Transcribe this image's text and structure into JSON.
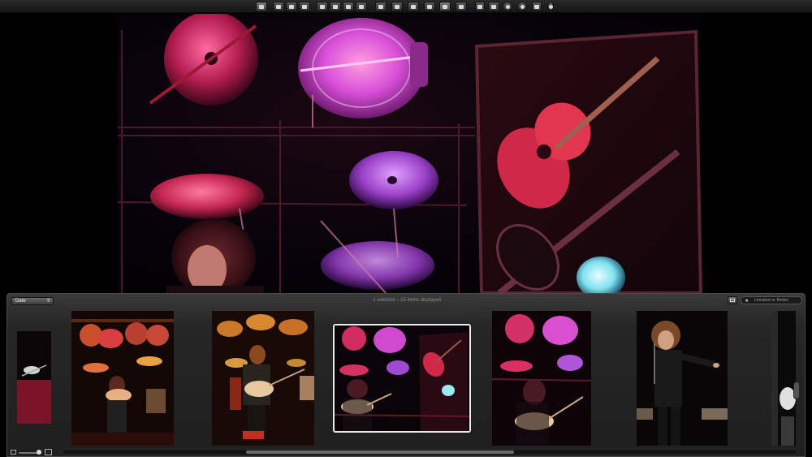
{
  "toolbar": {
    "icons": [
      "pointer-tool-icon",
      "rotate-tool-icon",
      "enhance-tool-icon",
      "red-eye-tool-icon",
      "straighten-tool-icon",
      "crop-tool-icon",
      "retouch-tool-icon",
      "brush-tool-icon",
      "single-view-icon",
      "compare-view-icon",
      "stack-view-icon",
      "survey-view-icon",
      "full-view-icon",
      "multi-view-icon",
      "faces-icon",
      "keywords-icon",
      "adjust-icon",
      "info-icon",
      "exit-fullscreen-icon",
      "brightness-slider-icon"
    ]
  },
  "browser": {
    "sort_label": "Date",
    "sort_arrow": "⇕",
    "status": "1 selected – 15 items displayed",
    "rating_filter": "Unrated or Better",
    "rating_icon": "★"
  },
  "thumbnails": [
    {
      "label": "partial-left"
    },
    {
      "label": "stage-wide"
    },
    {
      "label": "guitarist-warm"
    },
    {
      "label": "drums-guitar-selected"
    },
    {
      "label": "drums-guitar-red"
    },
    {
      "label": "singer-pointing"
    },
    {
      "label": "partial-right"
    }
  ],
  "colors": {
    "cymbal_pink": "#e8306c",
    "drum_magenta": "#d84fd8",
    "cymbal_violet": "#b560e0",
    "guitar_red": "#e82a4c",
    "spot_cyan": "#7fe0f0",
    "warm_stage": "#d8801c"
  }
}
